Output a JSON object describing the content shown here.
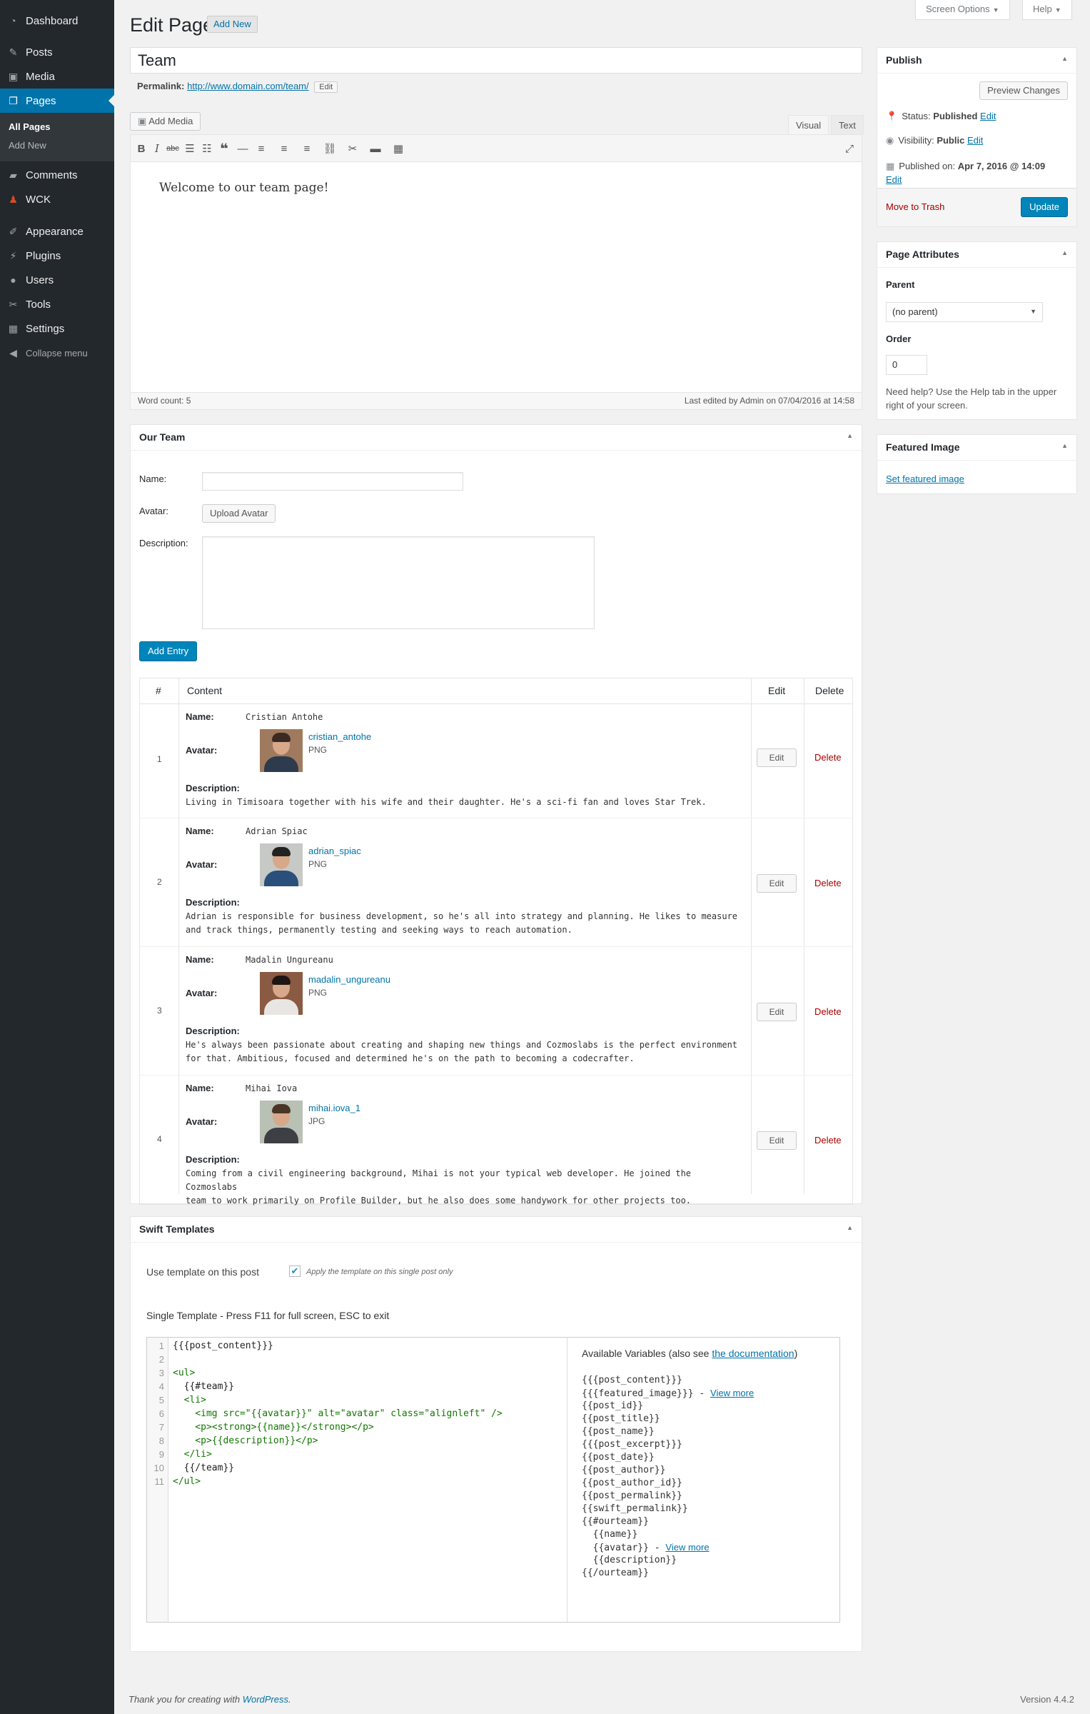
{
  "sidebar": {
    "items": [
      {
        "label": "Dashboard",
        "icon": "dashboard-icon"
      },
      {
        "label": "Posts",
        "icon": "pin-icon"
      },
      {
        "label": "Media",
        "icon": "media-icon"
      },
      {
        "label": "Pages",
        "icon": "pages-icon"
      },
      {
        "label": "Comments",
        "icon": "comment-icon"
      },
      {
        "label": "WCK",
        "icon": "wck-icon"
      },
      {
        "label": "Appearance",
        "icon": "brush-icon"
      },
      {
        "label": "Plugins",
        "icon": "plugin-icon"
      },
      {
        "label": "Users",
        "icon": "users-icon"
      },
      {
        "label": "Tools",
        "icon": "wrench-icon"
      },
      {
        "label": "Settings",
        "icon": "settings-icon"
      }
    ],
    "sub_items": [
      "All Pages",
      "Add New"
    ],
    "collapse": "Collapse menu"
  },
  "header": {
    "title": "Edit Page",
    "add_new": "Add New",
    "screen_options": "Screen Options",
    "help": "Help"
  },
  "post": {
    "title": "Team",
    "permalink_label": "Permalink:",
    "permalink_url": "http://www.domain.com/team/",
    "permalink_edit": "Edit"
  },
  "editor": {
    "add_media": "Add Media",
    "tab_visual": "Visual",
    "tab_text": "Text",
    "content": "Welcome to our team page!",
    "word_count": "Word count: 5",
    "last_edited": "Last edited by Admin on 07/04/2016 at 14:58"
  },
  "our_team": {
    "title": "Our Team",
    "name_label": "Name:",
    "avatar_label": "Avatar:",
    "upload_avatar": "Upload Avatar",
    "description_label": "Description:",
    "add_entry": "Add Entry",
    "columns": [
      "#",
      "Content",
      "Edit",
      "Delete"
    ],
    "row_labels": {
      "name": "Name:",
      "avatar": "Avatar:",
      "description": "Description:"
    },
    "edit_label": "Edit",
    "delete_label": "Delete",
    "entries": [
      {
        "num": "1",
        "name": "Cristian Antohe",
        "avatar_file": "cristian_antohe",
        "avatar_type": "PNG",
        "desc": [
          "Living in Timisoara together with his wife and their daughter. He's a sci-fi fan and loves Star Trek."
        ]
      },
      {
        "num": "2",
        "name": "Adrian Spiac",
        "avatar_file": "adrian_spiac",
        "avatar_type": "PNG",
        "desc": [
          "Adrian is responsible for business development, so he's all into strategy and planning. He likes to measure",
          "and track things, permanently testing and seeking ways to reach automation."
        ]
      },
      {
        "num": "3",
        "name": "Madalin Ungureanu",
        "avatar_file": "madalin_ungureanu",
        "avatar_type": "PNG",
        "desc": [
          "He's always been passionate about creating and shaping new things and Cozmoslabs is the perfect environment",
          "for that. Ambitious, focused and determined he's on the path to becoming a codecrafter."
        ]
      },
      {
        "num": "4",
        "name": "Mihai Iova",
        "avatar_file": "mihai.iova_1",
        "avatar_type": "JPG",
        "desc": [
          "Coming from a civil engineering background, Mihai is not your typical web developer. He joined the Cozmoslabs",
          "team to work primarily on Profile Builder, but he also does some handywork for other projects too."
        ]
      }
    ]
  },
  "swift": {
    "title": "Swift Templates",
    "use_template": "Use template on this post",
    "apply_note": "Apply the template on this single post only",
    "single_template": "Single Template - Press F11 for full screen, ESC to exit",
    "code_lines": [
      "{{{post_content}}}",
      "",
      "<ul>",
      "  {{#team}}",
      "  <li>",
      "    <img src=\"{{avatar}}\" alt=\"avatar\" class=\"alignleft\" />",
      "    <p><strong>{{name}}</strong></p>",
      "    <p>{{description}}</p>",
      "  </li>",
      "  {{/team}}",
      "</ul>"
    ],
    "available_prefix": "Available Variables (also see ",
    "available_link": "the documentation",
    "available_suffix": ")",
    "variables": [
      "{{{post_content}}}",
      "{{{featured_image}}} - ",
      "{{post_id}}",
      "{{post_title}}",
      "{{post_name}}",
      "{{{post_excerpt}}}",
      "{{post_date}}",
      "{{post_author}}",
      "{{post_author_id}}",
      "{{post_permalink}}",
      "{{swift_permalink}}",
      "{{#ourteam}}",
      "  {{name}}",
      "  {{avatar}} - ",
      "  {{description}}",
      "{{/ourteam}}"
    ],
    "view_more": "View more"
  },
  "publish": {
    "title": "Publish",
    "preview": "Preview Changes",
    "status_label": "Status:",
    "status_value": "Published",
    "visibility_label": "Visibility:",
    "visibility_value": "Public",
    "published_label": "Published on:",
    "published_value": "Apr 7, 2016 @ 14:09",
    "edit": "Edit",
    "trash": "Move to Trash",
    "update": "Update"
  },
  "attributes": {
    "title": "Page Attributes",
    "parent_label": "Parent",
    "parent_value": "(no parent)",
    "order_label": "Order",
    "order_value": "0",
    "help_text_1": "Need help? Use the Help tab in the upper",
    "help_text_2": "right of your screen."
  },
  "featured": {
    "title": "Featured Image",
    "link": "Set featured image"
  },
  "footer": {
    "thanks": "Thank you for creating with ",
    "wp": "WordPress",
    "thanks_end": ".",
    "version": "Version 4.4.2"
  },
  "colors": {
    "accent": "#0073aa",
    "sidebar": "#23282d",
    "primary_button": "#0085ba",
    "delete": "#aa0000"
  }
}
